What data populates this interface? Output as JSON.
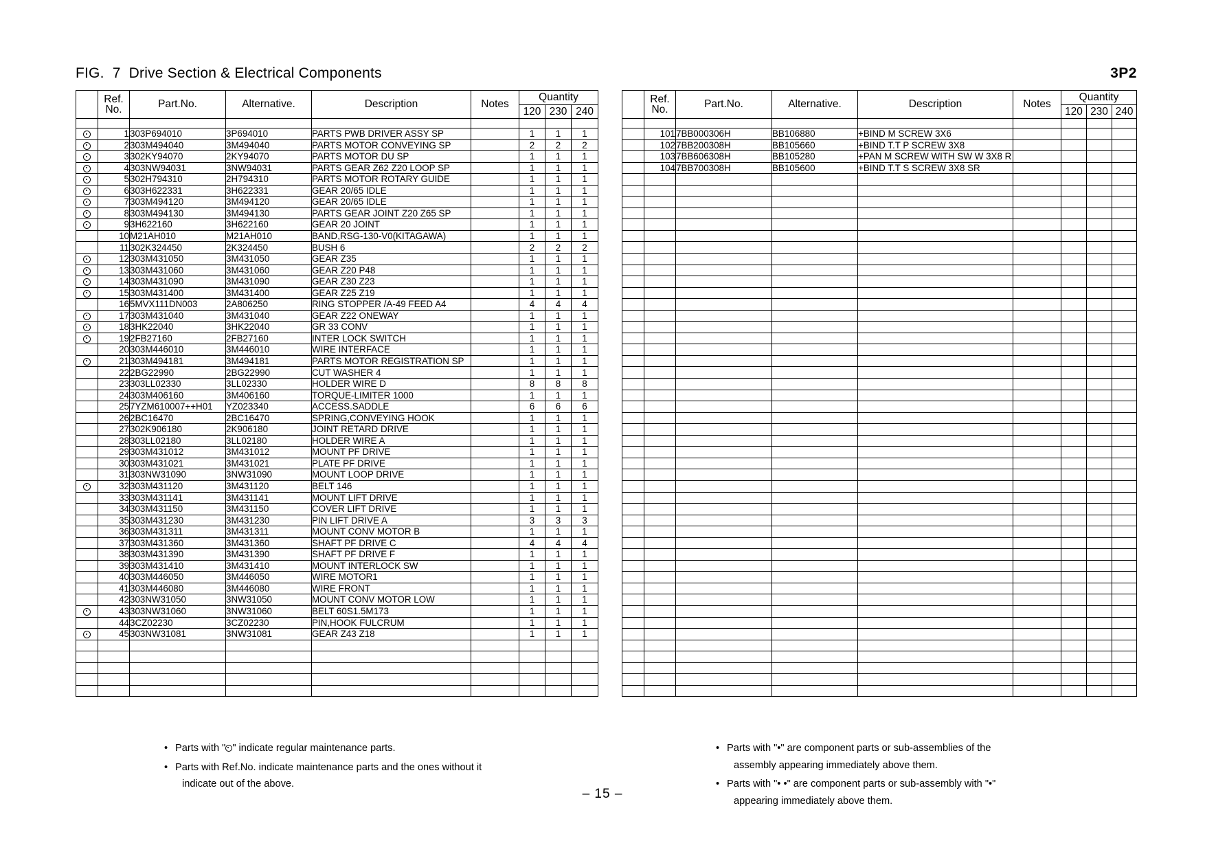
{
  "header": {
    "figure_title": "FIG.  7  Drive Section & Electrical Components",
    "page_code": "3P2"
  },
  "table_headers": {
    "mark": "",
    "ref_no_line1": "Ref.",
    "ref_no_line2": "No.",
    "part_no": "Part.No.",
    "alternative": "Alternative.",
    "description": "Description",
    "notes": "Notes",
    "quantity": "Quantity",
    "qty_cols": [
      "120",
      "230",
      "240"
    ]
  },
  "left_table": {
    "rows": [
      {
        "mark": "dot",
        "ref": "1",
        "part": "303P694010",
        "alt": "3P694010",
        "desc": "PARTS PWB DRIVER ASSY SP",
        "notes": "",
        "q": [
          "1",
          "1",
          "1"
        ]
      },
      {
        "mark": "dot",
        "ref": "2",
        "part": "303M494040",
        "alt": "3M494040",
        "desc": "PARTS MOTOR CONVEYING SP",
        "notes": "",
        "q": [
          "2",
          "2",
          "2"
        ]
      },
      {
        "mark": "dot",
        "ref": "3",
        "part": "302KY94070",
        "alt": "2KY94070",
        "desc": "PARTS MOTOR DU SP",
        "notes": "",
        "q": [
          "1",
          "1",
          "1"
        ]
      },
      {
        "mark": "dot",
        "ref": "4",
        "part": "303NW94031",
        "alt": "3NW94031",
        "desc": "PARTS GEAR Z62 Z20 LOOP SP",
        "notes": "",
        "q": [
          "1",
          "1",
          "1"
        ]
      },
      {
        "mark": "dot",
        "ref": "5",
        "part": "302H794310",
        "alt": "2H794310",
        "desc": "PARTS MOTOR ROTARY GUIDE",
        "notes": "",
        "q": [
          "1",
          "1",
          "1"
        ]
      },
      {
        "mark": "dot",
        "ref": "6",
        "part": "303H622331",
        "alt": "3H622331",
        "desc": "GEAR 20/65 IDLE",
        "notes": "",
        "q": [
          "1",
          "1",
          "1"
        ]
      },
      {
        "mark": "dot",
        "ref": "7",
        "part": "303M494120",
        "alt": "3M494120",
        "desc": "GEAR 20/65 IDLE",
        "notes": "",
        "q": [
          "1",
          "1",
          "1"
        ]
      },
      {
        "mark": "dot",
        "ref": "8",
        "part": "303M494130",
        "alt": "3M494130",
        "desc": "PARTS GEAR JOINT Z20 Z65 SP",
        "notes": "",
        "q": [
          "1",
          "1",
          "1"
        ]
      },
      {
        "mark": "dot",
        "ref": "9",
        "part": "3H622160",
        "alt": "3H622160",
        "desc": "GEAR 20 JOINT",
        "notes": "",
        "q": [
          "1",
          "1",
          "1"
        ]
      },
      {
        "mark": "",
        "ref": "10",
        "part": "M21AH010",
        "alt": "M21AH010",
        "desc": "BAND,RSG-130-V0(KITAGAWA)",
        "notes": "",
        "q": [
          "1",
          "1",
          "1"
        ]
      },
      {
        "mark": "",
        "ref": "11",
        "part": "302K324450",
        "alt": "2K324450",
        "desc": "BUSH 6",
        "notes": "",
        "q": [
          "2",
          "2",
          "2"
        ]
      },
      {
        "mark": "dot",
        "ref": "12",
        "part": "303M431050",
        "alt": "3M431050",
        "desc": "GEAR Z35",
        "notes": "",
        "q": [
          "1",
          "1",
          "1"
        ]
      },
      {
        "mark": "dot",
        "ref": "13",
        "part": "303M431060",
        "alt": "3M431060",
        "desc": "GEAR Z20 P48",
        "notes": "",
        "q": [
          "1",
          "1",
          "1"
        ]
      },
      {
        "mark": "dot",
        "ref": "14",
        "part": "303M431090",
        "alt": "3M431090",
        "desc": "GEAR Z30 Z23",
        "notes": "",
        "q": [
          "1",
          "1",
          "1"
        ]
      },
      {
        "mark": "dot",
        "ref": "15",
        "part": "303M431400",
        "alt": "3M431400",
        "desc": "GEAR Z25 Z19",
        "notes": "",
        "q": [
          "1",
          "1",
          "1"
        ]
      },
      {
        "mark": "",
        "ref": "16",
        "part": "5MVX111DN003",
        "alt": "2A806250",
        "desc": "RING STOPPER /A-49 FEED A4",
        "notes": "",
        "q": [
          "4",
          "4",
          "4"
        ]
      },
      {
        "mark": "dot",
        "ref": "17",
        "part": "303M431040",
        "alt": "3M431040",
        "desc": "GEAR Z22 ONEWAY",
        "notes": "",
        "q": [
          "1",
          "1",
          "1"
        ]
      },
      {
        "mark": "dot",
        "ref": "18",
        "part": "3HK22040",
        "alt": "3HK22040",
        "desc": "GR 33 CONV",
        "notes": "",
        "q": [
          "1",
          "1",
          "1"
        ]
      },
      {
        "mark": "dot",
        "ref": "19",
        "part": "2FB27160",
        "alt": "2FB27160",
        "desc": "INTER LOCK SWITCH",
        "notes": "",
        "q": [
          "1",
          "1",
          "1"
        ]
      },
      {
        "mark": "",
        "ref": "20",
        "part": "303M446010",
        "alt": "3M446010",
        "desc": "WIRE INTERFACE",
        "notes": "",
        "q": [
          "1",
          "1",
          "1"
        ]
      },
      {
        "mark": "dot",
        "ref": "21",
        "part": "303M494181",
        "alt": "3M494181",
        "desc": "PARTS MOTOR REGISTRATION SP",
        "notes": "",
        "q": [
          "1",
          "1",
          "1"
        ]
      },
      {
        "mark": "",
        "ref": "22",
        "part": "2BG22990",
        "alt": "2BG22990",
        "desc": "CUT WASHER 4",
        "notes": "",
        "q": [
          "1",
          "1",
          "1"
        ]
      },
      {
        "mark": "",
        "ref": "23",
        "part": "303LL02330",
        "alt": "3LL02330",
        "desc": "HOLDER WIRE D",
        "notes": "",
        "q": [
          "8",
          "8",
          "8"
        ]
      },
      {
        "mark": "",
        "ref": "24",
        "part": "303M406160",
        "alt": "3M406160",
        "desc": "TORQUE-LIMITER 1000",
        "notes": "",
        "q": [
          "1",
          "1",
          "1"
        ]
      },
      {
        "mark": "",
        "ref": "25",
        "part": "7YZM610007++H01",
        "alt": "YZ023340",
        "desc": "ACCESS.SADDLE",
        "notes": "",
        "q": [
          "6",
          "6",
          "6"
        ]
      },
      {
        "mark": "",
        "ref": "26",
        "part": "2BC16470",
        "alt": "2BC16470",
        "desc": "SPRING,CONVEYING HOOK",
        "notes": "",
        "q": [
          "1",
          "1",
          "1"
        ]
      },
      {
        "mark": "",
        "ref": "27",
        "part": "302K906180",
        "alt": "2K906180",
        "desc": "JOINT RETARD DRIVE",
        "notes": "",
        "q": [
          "1",
          "1",
          "1"
        ]
      },
      {
        "mark": "",
        "ref": "28",
        "part": "303LL02180",
        "alt": "3LL02180",
        "desc": "HOLDER WIRE A",
        "notes": "",
        "q": [
          "1",
          "1",
          "1"
        ]
      },
      {
        "mark": "",
        "ref": "29",
        "part": "303M431012",
        "alt": "3M431012",
        "desc": "MOUNT PF DRIVE",
        "notes": "",
        "q": [
          "1",
          "1",
          "1"
        ]
      },
      {
        "mark": "",
        "ref": "30",
        "part": "303M431021",
        "alt": "3M431021",
        "desc": "PLATE PF DRIVE",
        "notes": "",
        "q": [
          "1",
          "1",
          "1"
        ]
      },
      {
        "mark": "",
        "ref": "31",
        "part": "303NW31090",
        "alt": "3NW31090",
        "desc": "MOUNT LOOP DRIVE",
        "notes": "",
        "q": [
          "1",
          "1",
          "1"
        ]
      },
      {
        "mark": "dot",
        "ref": "32",
        "part": "303M431120",
        "alt": "3M431120",
        "desc": "BELT 146",
        "notes": "",
        "q": [
          "1",
          "1",
          "1"
        ]
      },
      {
        "mark": "",
        "ref": "33",
        "part": "303M431141",
        "alt": "3M431141",
        "desc": "MOUNT LIFT DRIVE",
        "notes": "",
        "q": [
          "1",
          "1",
          "1"
        ]
      },
      {
        "mark": "",
        "ref": "34",
        "part": "303M431150",
        "alt": "3M431150",
        "desc": "COVER LIFT DRIVE",
        "notes": "",
        "q": [
          "1",
          "1",
          "1"
        ]
      },
      {
        "mark": "",
        "ref": "35",
        "part": "303M431230",
        "alt": "3M431230",
        "desc": "PIN LIFT DRIVE A",
        "notes": "",
        "q": [
          "3",
          "3",
          "3"
        ]
      },
      {
        "mark": "",
        "ref": "36",
        "part": "303M431311",
        "alt": "3M431311",
        "desc": "MOUNT CONV MOTOR B",
        "notes": "",
        "q": [
          "1",
          "1",
          "1"
        ]
      },
      {
        "mark": "",
        "ref": "37",
        "part": "303M431360",
        "alt": "3M431360",
        "desc": "SHAFT PF DRIVE C",
        "notes": "",
        "q": [
          "4",
          "4",
          "4"
        ]
      },
      {
        "mark": "",
        "ref": "38",
        "part": "303M431390",
        "alt": "3M431390",
        "desc": "SHAFT PF DRIVE F",
        "notes": "",
        "q": [
          "1",
          "1",
          "1"
        ]
      },
      {
        "mark": "",
        "ref": "39",
        "part": "303M431410",
        "alt": "3M431410",
        "desc": "MOUNT INTERLOCK SW",
        "notes": "",
        "q": [
          "1",
          "1",
          "1"
        ]
      },
      {
        "mark": "",
        "ref": "40",
        "part": "303M446050",
        "alt": "3M446050",
        "desc": "WIRE MOTOR1",
        "notes": "",
        "q": [
          "1",
          "1",
          "1"
        ]
      },
      {
        "mark": "",
        "ref": "41",
        "part": "303M446080",
        "alt": "3M446080",
        "desc": "WIRE FRONT",
        "notes": "",
        "q": [
          "1",
          "1",
          "1"
        ]
      },
      {
        "mark": "",
        "ref": "42",
        "part": "303NW31050",
        "alt": "3NW31050",
        "desc": "MOUNT CONV MOTOR LOW",
        "notes": "",
        "q": [
          "1",
          "1",
          "1"
        ]
      },
      {
        "mark": "dot",
        "ref": "43",
        "part": "303NW31060",
        "alt": "3NW31060",
        "desc": "BELT 60S1.5M173",
        "notes": "",
        "q": [
          "1",
          "1",
          "1"
        ]
      },
      {
        "mark": "",
        "ref": "44",
        "part": "3CZ02230",
        "alt": "3CZ02230",
        "desc": "PIN,HOOK FULCRUM",
        "notes": "",
        "q": [
          "1",
          "1",
          "1"
        ]
      },
      {
        "mark": "dot",
        "ref": "45",
        "part": "303NW31081",
        "alt": "3NW31081",
        "desc": "GEAR Z43 Z18",
        "notes": "",
        "q": [
          "1",
          "1",
          "1"
        ]
      }
    ]
  },
  "right_table": {
    "rows": [
      {
        "mark": "",
        "ref": "101",
        "part": "7BB000306H",
        "alt": "BB106880",
        "desc": "+BIND M SCREW 3X6",
        "notes": "",
        "q": [
          "",
          "",
          ""
        ]
      },
      {
        "mark": "",
        "ref": "102",
        "part": "7BB200308H",
        "alt": "BB105660",
        "desc": "+BIND T.T P SCREW 3X8",
        "notes": "",
        "q": [
          "",
          "",
          ""
        ]
      },
      {
        "mark": "",
        "ref": "103",
        "part": "7BB606308H",
        "alt": "BB105280",
        "desc": "+PAN M SCREW WITH SW W 3X8 R",
        "notes": "",
        "q": [
          "",
          "",
          ""
        ]
      },
      {
        "mark": "",
        "ref": "104",
        "part": "7BB700308H",
        "alt": "BB105600",
        "desc": "+BIND T.T S SCREW 3X8 SR",
        "notes": "",
        "q": [
          "",
          "",
          ""
        ]
      }
    ]
  },
  "footnotes": {
    "left": [
      {
        "pre": "Parts with \"",
        "icon": "maintenance-dot",
        "post": "\" indicate regular maintenance parts.",
        "cont": ""
      },
      {
        "pre": "Parts with Ref.No. indicate maintenance parts and the ones without it",
        "icon": "",
        "post": "",
        "cont": "indicate out of the above."
      }
    ],
    "right": [
      {
        "text": "Parts with \"•\" are component parts or sub-assemblies of the",
        "cont": "assembly appearing immediately above them."
      },
      {
        "text": "Parts with \"• •\" are component parts or sub-assembly with \"•\"",
        "cont": "appearing immediately above them."
      }
    ]
  },
  "page_number": "–  15  –"
}
